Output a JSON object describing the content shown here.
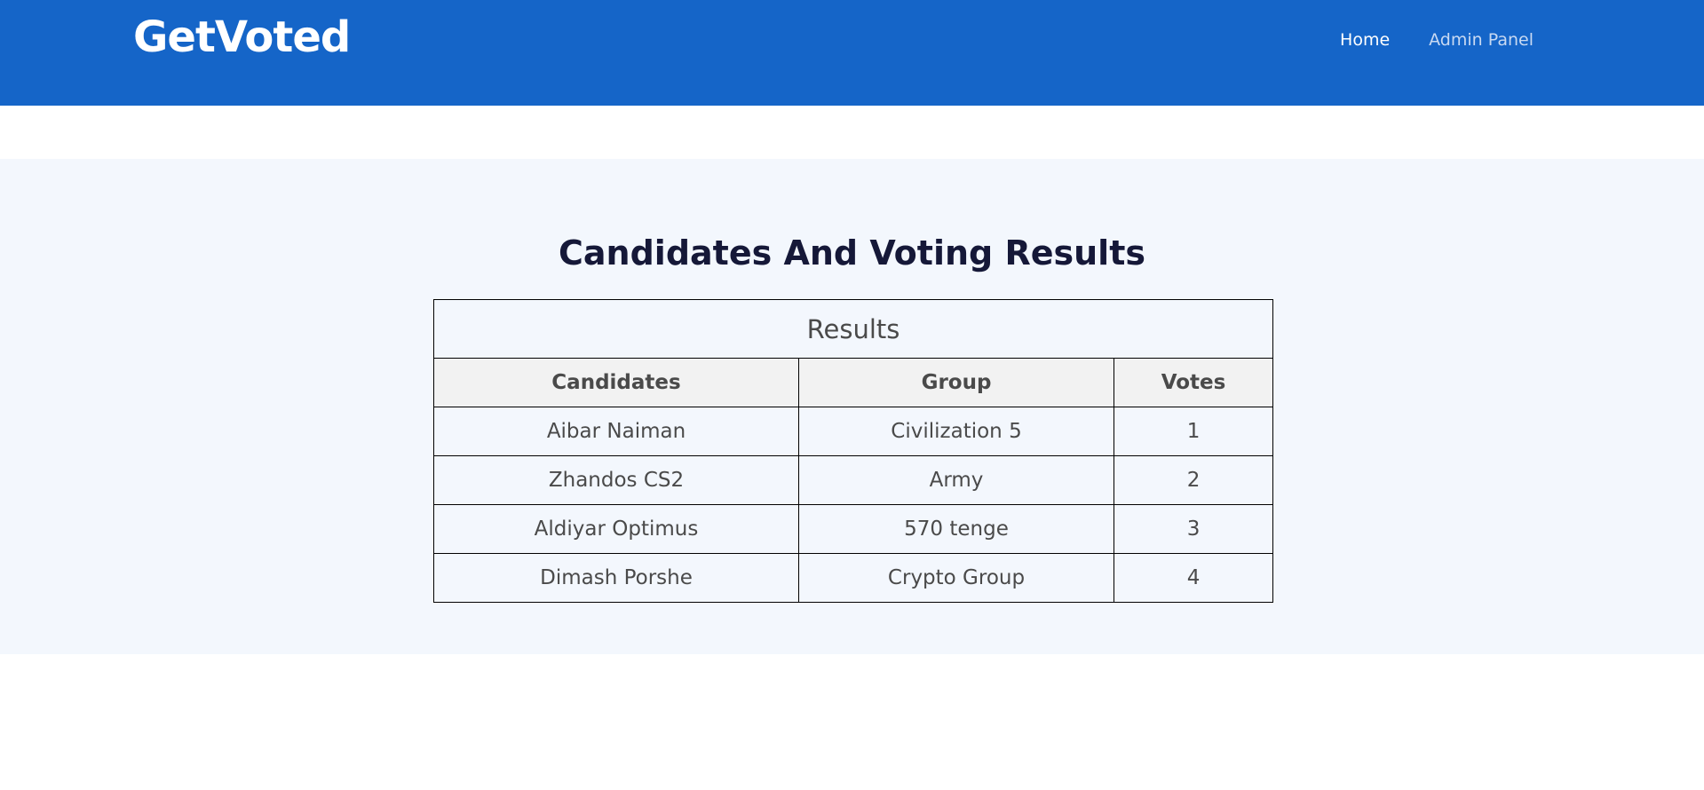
{
  "header": {
    "brand": "GetVoted",
    "nav": [
      {
        "label": "Home"
      },
      {
        "label": "Admin Panel"
      }
    ]
  },
  "main": {
    "title": "Candidates And Voting Results",
    "table": {
      "caption": "Results",
      "columns": [
        "Candidates",
        "Group",
        "Votes"
      ],
      "rows": [
        [
          "Aibar Naiman",
          "Civilization 5",
          "1"
        ],
        [
          "Zhandos CS2",
          "Army",
          "2"
        ],
        [
          "Aldiyar Optimus",
          "570 tenge",
          "3"
        ],
        [
          "Dimash Porshe",
          "Crypto Group",
          "4"
        ]
      ]
    }
  },
  "colors": {
    "header_bg": "#1565c8",
    "section_bg": "#f3f7fd",
    "title_text": "#151838"
  }
}
